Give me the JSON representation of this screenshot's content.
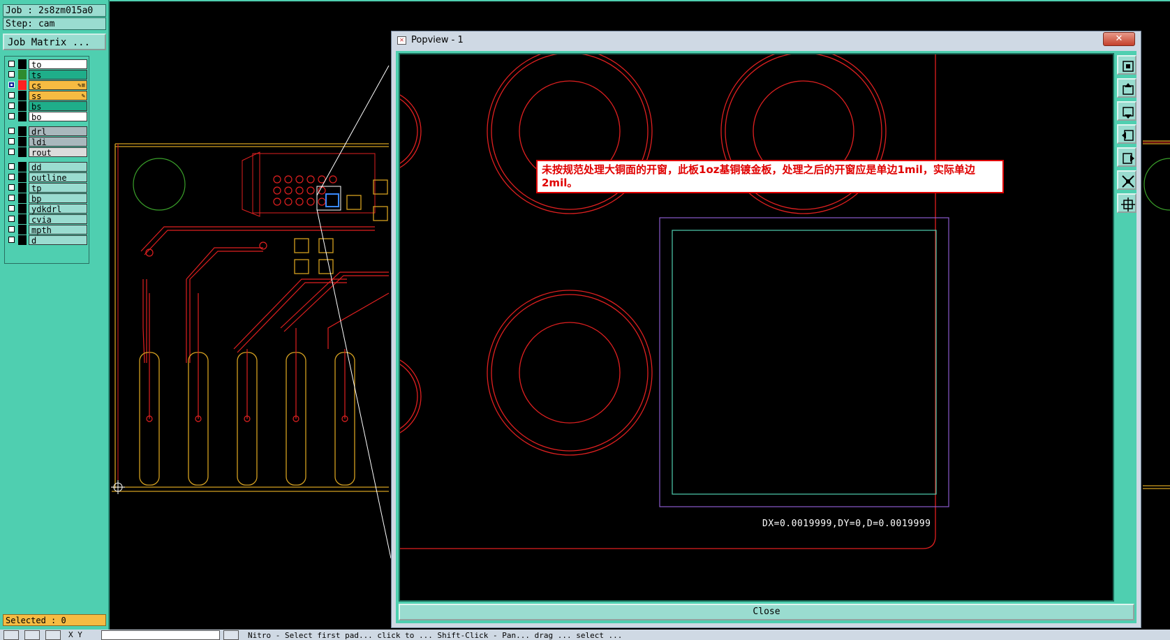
{
  "job": {
    "line": "Job : 2s8zm015a0",
    "step_line": "Step: cam",
    "matrix_label": "Job Matrix ..."
  },
  "layers": [
    {
      "name": "to",
      "swatch": "#000000",
      "bg": "#ffffff",
      "checked": false,
      "mark": ""
    },
    {
      "name": "ts",
      "swatch": "#2e8b2e",
      "bg": "#1fae8a",
      "checked": false,
      "mark": ""
    },
    {
      "name": "cs",
      "swatch": "#ff2020",
      "bg": "#f6bb42",
      "checked": true,
      "mark": "✎≡"
    },
    {
      "name": "ss",
      "swatch": "#000000",
      "bg": "#f6bb42",
      "checked": false,
      "mark": "✎"
    },
    {
      "name": "bs",
      "swatch": "#000000",
      "bg": "#1fae8a",
      "checked": false,
      "mark": ""
    },
    {
      "name": "bo",
      "swatch": "#000000",
      "bg": "#ffffff",
      "checked": false,
      "mark": ""
    },
    {
      "name": "drl",
      "swatch": "#000000",
      "bg": "#a9b8bd",
      "checked": false,
      "mark": ""
    },
    {
      "name": "ldi",
      "swatch": "#000000",
      "bg": "#a9b8bd",
      "checked": false,
      "mark": ""
    },
    {
      "name": "rout",
      "swatch": "#000000",
      "bg": "#dcdcdc",
      "checked": false,
      "mark": ""
    },
    {
      "name": "dd",
      "swatch": "#000000",
      "bg": "#9adcd0",
      "checked": false,
      "mark": ""
    },
    {
      "name": "outline",
      "swatch": "#000000",
      "bg": "#9adcd0",
      "checked": false,
      "mark": ""
    },
    {
      "name": "tp",
      "swatch": "#000000",
      "bg": "#9adcd0",
      "checked": false,
      "mark": ""
    },
    {
      "name": "bp",
      "swatch": "#000000",
      "bg": "#9adcd0",
      "checked": false,
      "mark": ""
    },
    {
      "name": "ydkdrl",
      "swatch": "#000000",
      "bg": "#9adcd0",
      "checked": false,
      "mark": ""
    },
    {
      "name": "cvia",
      "swatch": "#000000",
      "bg": "#9adcd0",
      "checked": false,
      "mark": ""
    },
    {
      "name": "mpth",
      "swatch": "#000000",
      "bg": "#9adcd0",
      "checked": false,
      "mark": ""
    },
    {
      "name": "d",
      "swatch": "#000000",
      "bg": "#9adcd0",
      "checked": false,
      "mark": ""
    }
  ],
  "selected_label": "Selected : 0",
  "popview": {
    "title": "Popview - 1",
    "annotation": "未按规范处理大铜面的开窗，此板1oz基铜镀金板，处理之后的开窗应是单边1mil，实际单边2mil。",
    "measure": "DX=0.0019999,DY=0,D=0.0019999",
    "close_label": "Close",
    "tools": [
      "zoom-fit-icon",
      "pan-up-icon",
      "pan-down-icon",
      "pan-left-icon",
      "pan-right-icon",
      "zoom-out-icon",
      "zoom-in-icon"
    ]
  },
  "status_bar": {
    "coord_label": "X Y",
    "message": "Nitro - Select first pad... click to ... Shift-Click - Pan... drag ... select ..."
  },
  "colors": {
    "panel": "#4fcfb0",
    "copper": "#e02020",
    "mask": "#d4a020",
    "outline": "#f6bb42",
    "purple": "#8a5acd",
    "cyan": "#4fcfb0"
  }
}
